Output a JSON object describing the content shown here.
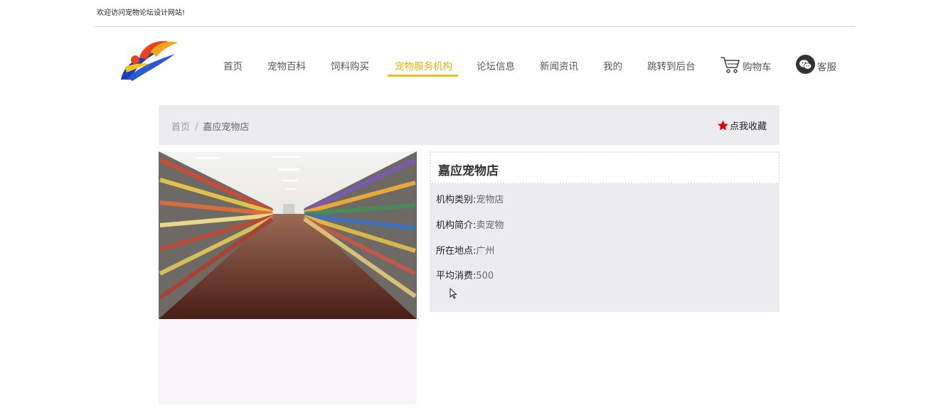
{
  "topbar": {
    "welcome": "欢迎访问宠物论坛设计网站!"
  },
  "nav": {
    "items": [
      {
        "label": "首页"
      },
      {
        "label": "宠物百科"
      },
      {
        "label": "饲料购买"
      },
      {
        "label": "宠物服务机构"
      },
      {
        "label": "论坛信息"
      },
      {
        "label": "新闻资讯"
      },
      {
        "label": "我的"
      },
      {
        "label": "跳转到后台"
      }
    ],
    "active_index": 3,
    "cart_label": "购物车",
    "service_label": "客服"
  },
  "breadcrumb": {
    "home": "首页",
    "separator": "/",
    "current": "嘉应宠物店",
    "favorite_label": "点我收藏"
  },
  "detail": {
    "name": "嘉应宠物店",
    "fields": [
      {
        "label": "机构类别:",
        "value": "宠物店"
      },
      {
        "label": "机构简介:",
        "value": "卖宠物"
      },
      {
        "label": "所在地点:",
        "value": "广州"
      },
      {
        "label": "平均消费:",
        "value": "500"
      }
    ]
  },
  "colors": {
    "accent": "#e0b20c",
    "panel_bg": "#ececef",
    "star": "#e00000"
  }
}
